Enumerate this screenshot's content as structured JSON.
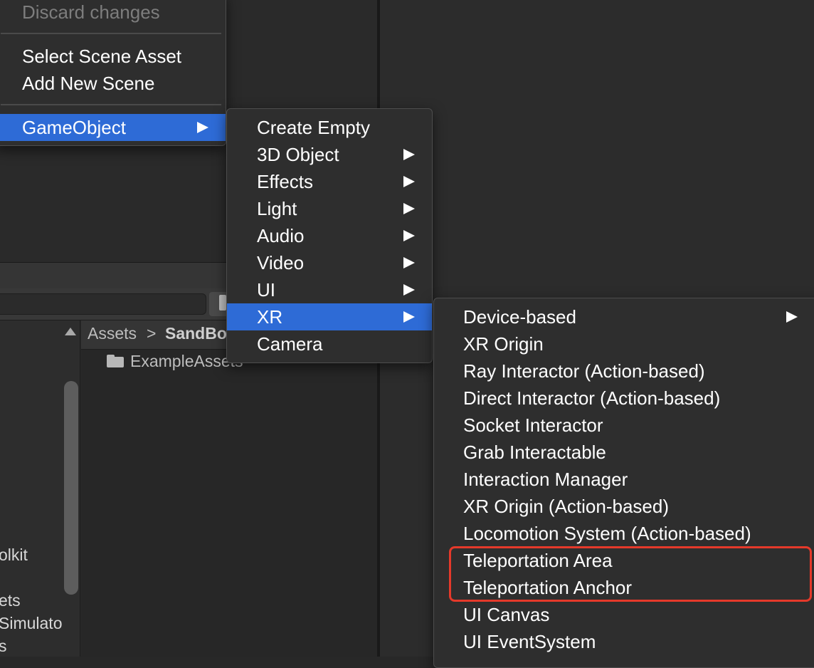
{
  "background": {
    "tree_items": [
      "olkit",
      "ets",
      "Simulato",
      "s"
    ],
    "breadcrumb": {
      "root": "Assets",
      "separator": ">",
      "current": "SandBo"
    },
    "folder": {
      "name": "ExampleAssets"
    }
  },
  "menu_root": {
    "items": [
      {
        "label": "Discard changes",
        "disabled": true
      },
      {
        "label": "Select Scene Asset"
      },
      {
        "label": "Add New Scene"
      },
      {
        "label": "GameObject",
        "selected": true,
        "submenu": true
      }
    ]
  },
  "menu_gameobject": {
    "items": [
      {
        "label": "Create Empty"
      },
      {
        "label": "3D Object",
        "submenu": true
      },
      {
        "label": "Effects",
        "submenu": true
      },
      {
        "label": "Light",
        "submenu": true
      },
      {
        "label": "Audio",
        "submenu": true
      },
      {
        "label": "Video",
        "submenu": true
      },
      {
        "label": "UI",
        "submenu": true
      },
      {
        "label": "XR",
        "selected": true,
        "submenu": true
      },
      {
        "label": "Camera"
      }
    ]
  },
  "menu_xr": {
    "items": [
      {
        "label": "Device-based",
        "submenu": true
      },
      {
        "label": "XR Origin"
      },
      {
        "label": "Ray Interactor (Action-based)"
      },
      {
        "label": "Direct Interactor (Action-based)"
      },
      {
        "label": "Socket Interactor"
      },
      {
        "label": "Grab Interactable"
      },
      {
        "label": "Interaction Manager"
      },
      {
        "label": "XR Origin (Action-based)"
      },
      {
        "label": "Locomotion System (Action-based)"
      },
      {
        "label": "Teleportation Area"
      },
      {
        "label": "Teleportation Anchor"
      },
      {
        "label": "UI Canvas"
      },
      {
        "label": "UI EventSystem"
      }
    ]
  },
  "colors": {
    "selection": "#2e6bd6",
    "highlight_box": "#e5392a"
  }
}
